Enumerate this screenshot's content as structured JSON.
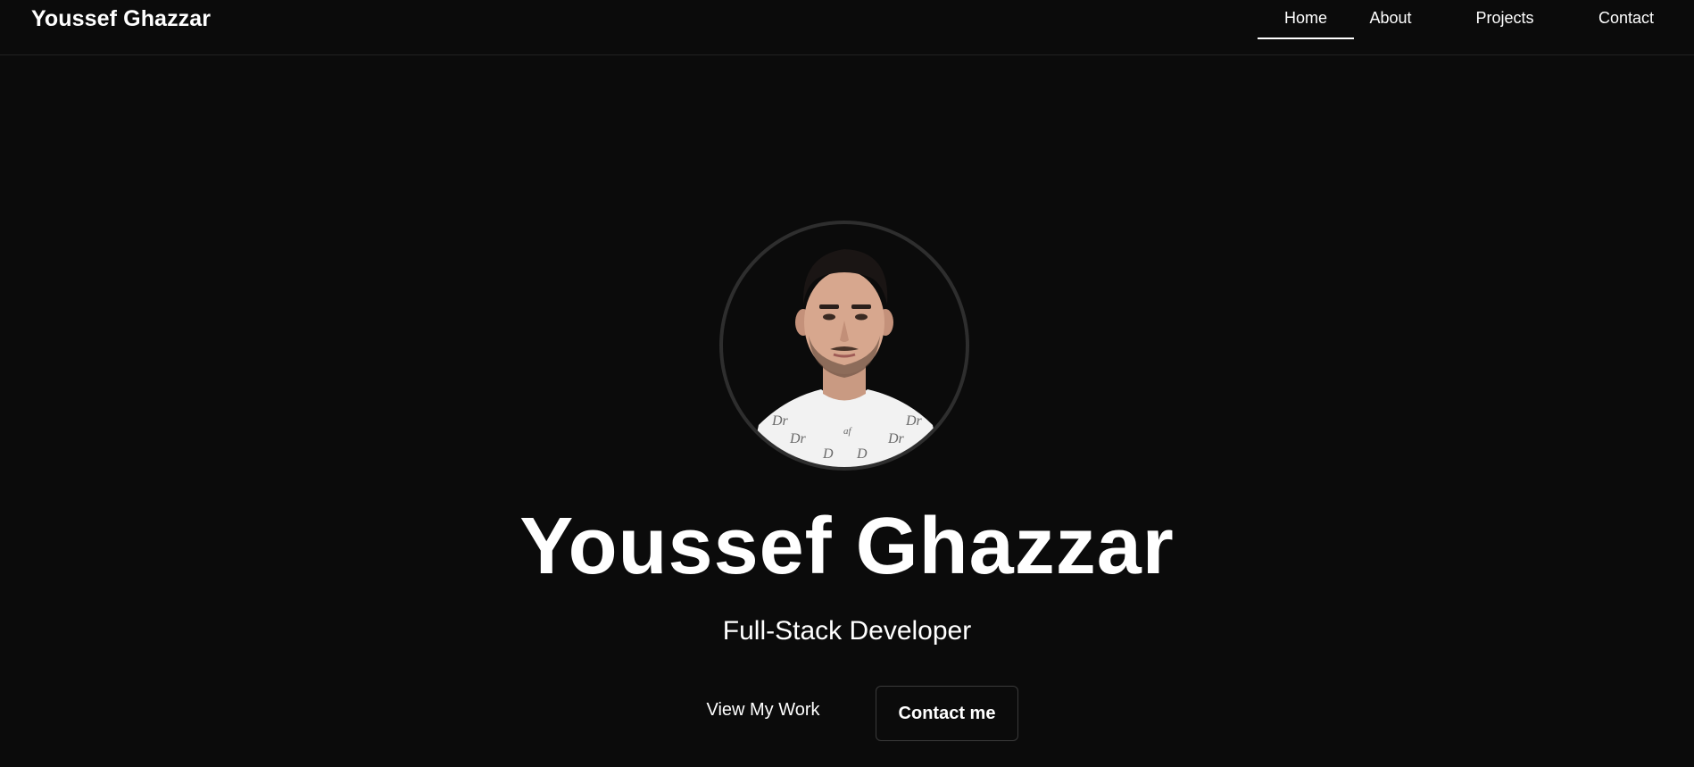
{
  "header": {
    "brand": "Youssef Ghazzar",
    "nav": [
      {
        "label": "Home",
        "active": true
      },
      {
        "label": "About",
        "active": false
      },
      {
        "label": "Projects",
        "active": false
      },
      {
        "label": "Contact",
        "active": false
      }
    ]
  },
  "hero": {
    "avatar_icon": "profile-photo",
    "name": "Youssef Ghazzar",
    "role": "Full-Stack Developer",
    "primary_cta": "View My Work",
    "secondary_cta": "Contact me"
  },
  "colors": {
    "background": "#0b0b0b",
    "text": "#ffffff",
    "border": "#3a3a3a",
    "avatar_ring": "#2e2e2e"
  }
}
